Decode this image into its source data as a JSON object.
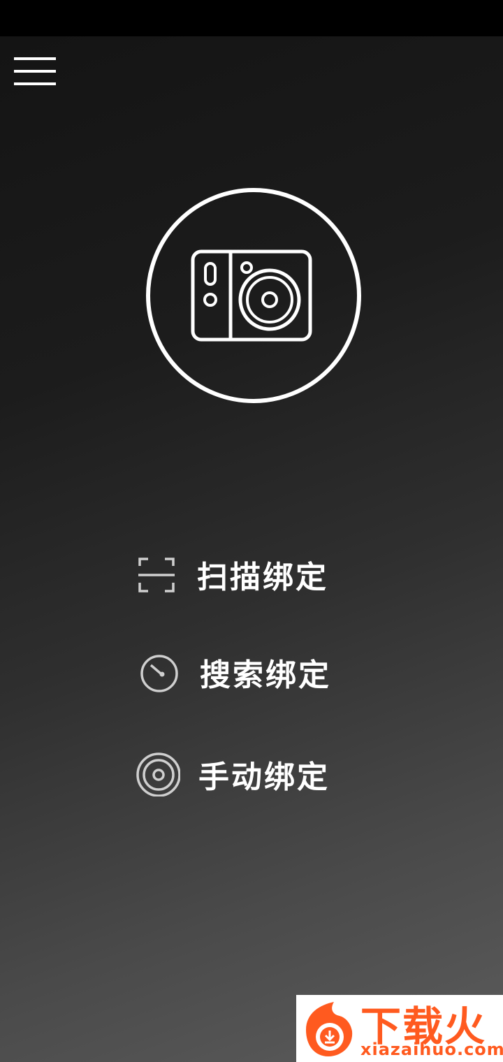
{
  "menu": {
    "icon": "hamburger-menu-icon"
  },
  "hero": {
    "icon": "action-camera-icon"
  },
  "options": [
    {
      "label": "扫描绑定",
      "icon": "scan-frame-icon"
    },
    {
      "label": "搜索绑定",
      "icon": "search-dial-icon"
    },
    {
      "label": "手动绑定",
      "icon": "target-rings-icon"
    }
  ],
  "watermark": {
    "title": "下载火",
    "site": "xiazaihuo.com",
    "icon": "flame-download-logo"
  },
  "colors": {
    "background_top": "#141414",
    "background_bottom": "#5c5c5c",
    "foreground": "#ffffff",
    "watermark_accent": "#ff5a1f"
  }
}
